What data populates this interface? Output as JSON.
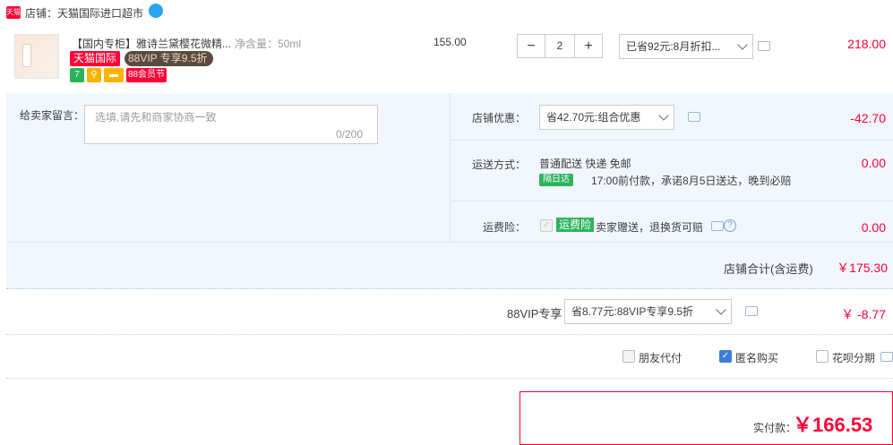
{
  "shop": {
    "badge": "天猫",
    "name": "店铺：天猫国际进口超市",
    "ww_icon": "chat-bubble-icon"
  },
  "item": {
    "title": "【国内专柜】雅诗兰黛樱花微精...",
    "spec": "净含量：50ml",
    "tag_tmall_intl": "天猫国际",
    "tag_88vip": "88VIP 专享9.5折",
    "icons": [
      "7",
      "⚲",
      "▬",
      "88会员节"
    ],
    "unit_price": "155.00",
    "qty_minus": "−",
    "qty_value": "2",
    "qty_plus": "+",
    "discount_select": "已省92元:8月折扣...",
    "total": "218.00"
  },
  "message": {
    "label": "给卖家留言：",
    "placeholder": "选填,请先和商家协商一致",
    "count": "0/200"
  },
  "shop_discount": {
    "label": "店铺优惠：",
    "select": "省42.70元:组合优惠",
    "amount": "-42.70"
  },
  "delivery": {
    "label": "运送方式：",
    "method": "普通配送 快递 免邮",
    "badge": "隔日达",
    "note": "17:00前付款，承诺8月5日送达，晚到必赔",
    "amount": "0.00"
  },
  "insurance": {
    "label": "运费险：",
    "badge": "运费险",
    "text": "卖家赠送，退换货可赔",
    "amount": "0.00"
  },
  "shop_total": {
    "label": "店铺合计(含运费)",
    "amount": "￥175.30"
  },
  "vip": {
    "label": "88VIP专享",
    "select": "省8.77元:88VIP专享9.5折",
    "amount": "￥ -8.77"
  },
  "options": {
    "friend_pay": "朋友代付",
    "anonymous": "匿名购买",
    "huabei": "花呗分期"
  },
  "payment": {
    "label": "实付款：",
    "amount": "￥166.53"
  },
  "colors": {
    "accent": "#ff0036",
    "section_bg": "#f2f7ff",
    "badge_green": "#2cb45c"
  }
}
